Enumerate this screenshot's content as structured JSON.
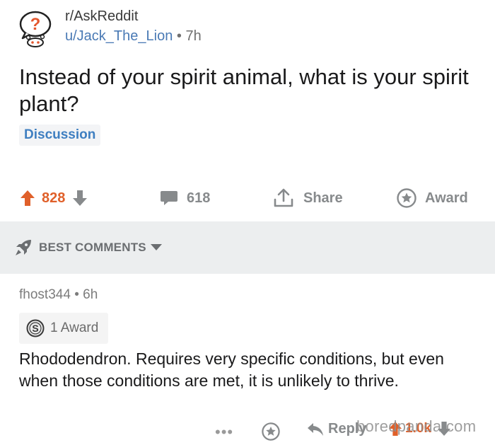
{
  "post": {
    "subreddit": "r/AskReddit",
    "user": "u/Jack_The_Lion",
    "separator": "•",
    "time": "7h",
    "title": "Instead of your spirit animal, what is your spirit plant?",
    "flair": "Discussion"
  },
  "actions": {
    "score": "828",
    "comments": "618",
    "share": "Share",
    "award": "Award"
  },
  "sort": {
    "label": "BEST COMMENTS"
  },
  "comment": {
    "author": "fhost344",
    "separator": "•",
    "time": "6h",
    "award_text": "1 Award",
    "body": "Rhododendron. Requires very specific conditions, but even when those conditions are met, it is unlikely to thrive.",
    "more": "•••",
    "reply": "Reply",
    "score": "1.0k"
  },
  "watermark": "boredpanda.com",
  "colors": {
    "upvote": "#e0602a",
    "link": "#4a7ab5",
    "flair": "#3f7fc1",
    "sort_bg": "#eceeef"
  }
}
